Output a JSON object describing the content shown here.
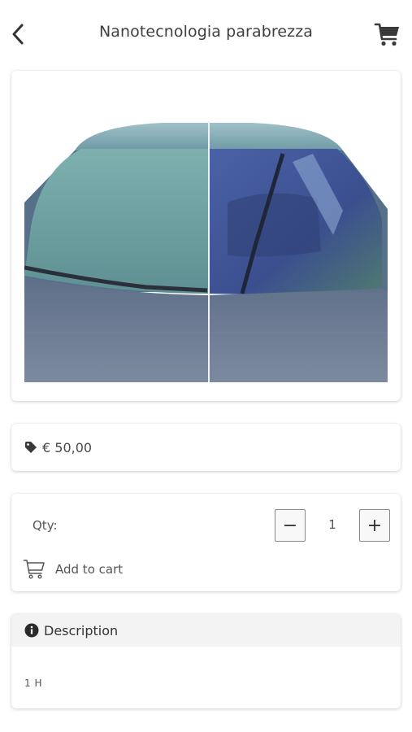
{
  "header": {
    "title": "Nanotecnologia parabrezza",
    "back_icon": "chevron-left-icon",
    "cart_icon": "cart-icon"
  },
  "product": {
    "image_subject": "windshield-before-after"
  },
  "price": {
    "icon": "tag-icon",
    "value": "€ 50,00"
  },
  "quantity": {
    "label": "Qty:",
    "value": "1",
    "minus_label": "−",
    "plus_label": "+"
  },
  "add_to_cart": {
    "label": "Add to cart",
    "icon": "cart-outline-icon"
  },
  "description": {
    "icon": "info-icon",
    "title": "Description",
    "body": "1 H"
  }
}
